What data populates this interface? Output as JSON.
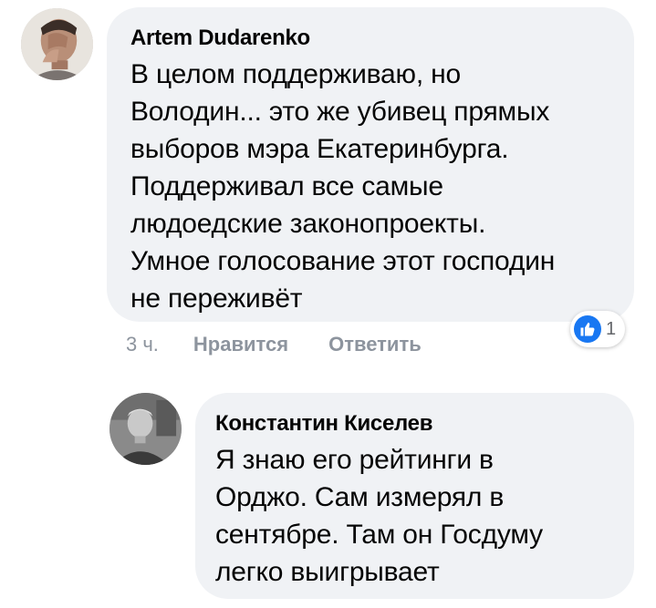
{
  "comments": [
    {
      "author": "Artem Dudarenko",
      "text": "В целом поддерживаю, но\nВолодин... это же убивец прямых\nвыборов мэра Екатеринбурга.\nПоддерживал все самые\nлюдоедские законопроекты.\nУмное голосование этот господин\nне переживёт",
      "time": "3 ч.",
      "like_label": "Нравится",
      "reply_label": "Ответить",
      "reaction_count": "1",
      "reaction_icon": "like-thumb-icon",
      "accent_color": "#1877f2"
    },
    {
      "author": "Константин Киселев",
      "text": "Я знаю его рейтинги в\nОрджо. Сам измерял в\nсентябре. Там он Госдуму\nлегко выигрывает"
    }
  ]
}
